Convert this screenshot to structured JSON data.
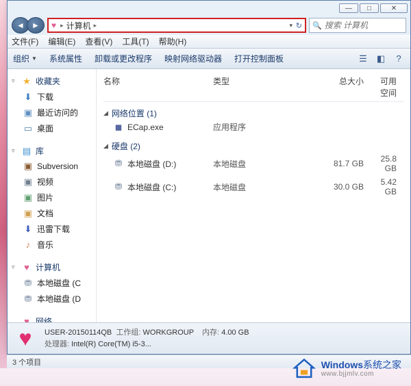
{
  "titlebar": {
    "min": "—",
    "max": "□",
    "close": "✕"
  },
  "breadcrumb": {
    "root": "计算机",
    "sep": "▸"
  },
  "search": {
    "placeholder": "搜索 计算机"
  },
  "menubar": {
    "file": "文件(F)",
    "edit": "编辑(E)",
    "view": "查看(V)",
    "tools": "工具(T)",
    "help": "帮助(H)"
  },
  "toolbar": {
    "organize": "组织",
    "properties": "系统属性",
    "uninstall": "卸载或更改程序",
    "map_drive": "映射网络驱动器",
    "control_panel": "打开控制面板"
  },
  "sidebar": {
    "favorites": {
      "label": "收藏夹",
      "items": [
        "下载",
        "最近访问的",
        "桌面"
      ]
    },
    "libraries": {
      "label": "库",
      "items": [
        "Subversion",
        "视频",
        "图片",
        "文档",
        "迅雷下载",
        "音乐"
      ]
    },
    "computer": {
      "label": "计算机",
      "items": [
        "本地磁盘 (C",
        "本地磁盘 (D"
      ]
    },
    "network": {
      "label": "网络"
    }
  },
  "columns": {
    "name": "名称",
    "type": "类型",
    "total": "总大小",
    "free": "可用空间"
  },
  "groups": {
    "netloc": {
      "label": "网络位置 (1)"
    },
    "disks": {
      "label": "硬盘 (2)"
    }
  },
  "items": {
    "ecap": {
      "name": "ECap.exe",
      "type": "应用程序"
    },
    "d": {
      "name": "本地磁盘 (D:)",
      "type": "本地磁盘",
      "total": "81.7 GB",
      "free": "25.8 GB"
    },
    "c": {
      "name": "本地磁盘 (C:)",
      "type": "本地磁盘",
      "total": "30.0 GB",
      "free": "5.42 GB"
    }
  },
  "details": {
    "name": "USER-20150114QB",
    "workgroup_label": "工作组:",
    "workgroup": "WORKGROUP",
    "memory_label": "内存:",
    "memory": "4.00 GB",
    "cpu_label": "处理器:",
    "cpu": "Intel(R) Core(TM) i5-3..."
  },
  "status": {
    "count": "3 个项目"
  },
  "watermark": {
    "brand": "Windows",
    "suffix": "系统之家",
    "url": "www.bjjmlv.com"
  }
}
